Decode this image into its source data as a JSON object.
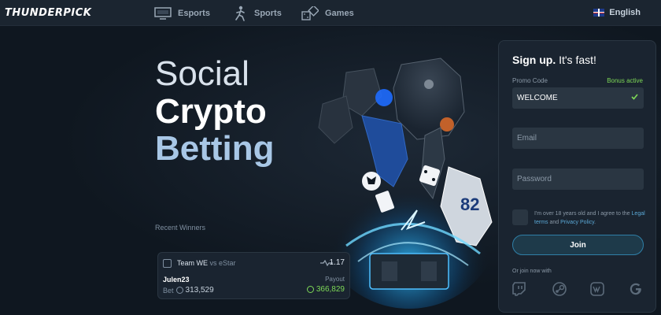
{
  "header": {
    "logo": "THUNDERPICK",
    "nav": [
      {
        "label": "Esports",
        "icon": "monitor-icon"
      },
      {
        "label": "Sports",
        "icon": "athlete-icon"
      },
      {
        "label": "Games",
        "icon": "games-icon"
      }
    ],
    "language": "English"
  },
  "hero": {
    "line1": "Social",
    "line2": "Crypto",
    "line3": "Betting"
  },
  "recent_winners": {
    "label": "Recent Winners",
    "card": {
      "team_a": "Team WE",
      "vs": "vs",
      "team_b": "eStar",
      "odds": "1.17",
      "user": "Julen23",
      "payout_label": "Payout",
      "bet_label": "Bet",
      "bet_amount": "313,529",
      "payout_amount": "366,829"
    }
  },
  "signup": {
    "title_bold": "Sign up.",
    "title_rest": "It's fast!",
    "promo_label": "Promo Code",
    "bonus_status": "Bonus active",
    "promo_value": "WELCOME",
    "email_placeholder": "Email",
    "password_placeholder": "Password",
    "terms_prefix": "I'm over 18 years old and I agree to the",
    "terms_link1": "Legal terms",
    "terms_and": "and",
    "terms_link2": "Privacy Policy",
    "terms_suffix": ".",
    "join_label": "Join",
    "or_join": "Or join now with",
    "social": [
      "twitch-icon",
      "steam-icon",
      "vk-icon",
      "google-icon"
    ]
  },
  "colors": {
    "background": "#0f1720",
    "panel": "#1a2430",
    "field": "#2a3642",
    "accent_green": "#7ed957",
    "link_blue": "#5aa8d6",
    "button_border": "#2f7fa7"
  }
}
